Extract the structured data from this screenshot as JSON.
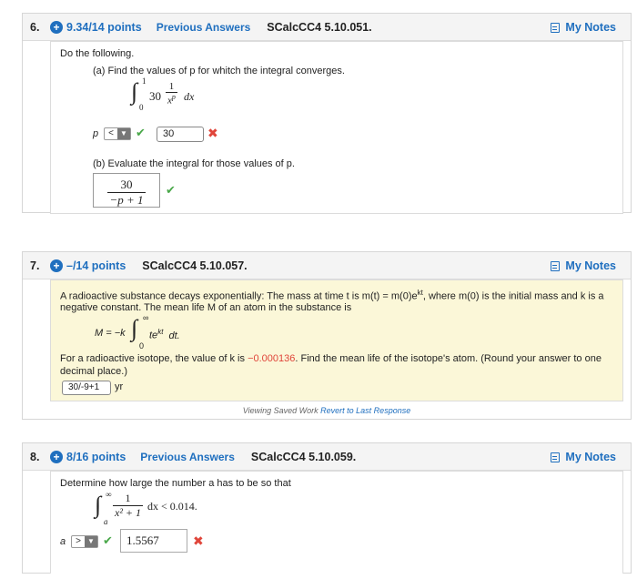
{
  "q6": {
    "number": "6.",
    "points": "9.34/14 points",
    "previous_answers": "Previous Answers",
    "id": "SCalcCC4 5.10.051.",
    "my_notes": "My Notes",
    "instruction": "Do the following.",
    "part_a": "(a) Find the values of p for whitch the integral converges.",
    "integral_coef": "30",
    "integral_upper": "1",
    "integral_lower": "0",
    "frac_num": "1",
    "frac_den": "x",
    "frac_den_exp": "p",
    "dx": "dx",
    "p_label": "p",
    "p_select_value": "<",
    "p_input_value": "30",
    "part_b": "(b) Evaluate the integral for those values of p.",
    "b_num": "30",
    "b_den": "−p + 1"
  },
  "q7": {
    "number": "7.",
    "points": "–/14 points",
    "id": "SCalcCC4 5.10.057.",
    "my_notes": "My Notes",
    "line1": "A radioactive substance decays exponentially: The mass at time t is m(t) = m(0)e",
    "line1_exp": "kt",
    "line1_rest": ", where m(0) is the initial mass and k is a",
    "line2": "negative constant. The mean life M of an atom in the substance is",
    "formula_lhs": "M = −k",
    "formula_upper": "∞",
    "formula_lower": "0",
    "formula_body": "te",
    "formula_exp": "kt",
    "formula_dt": "dt.",
    "line3_pre": "For a radioactive isotope, the value of k is ",
    "k_value": "−0.000136",
    "line3_post": ". Find the mean life of the isotope's atom. (Round your answer to one",
    "line4": "decimal place.)",
    "answer_value": "30/-9+1",
    "unit": "yr"
  },
  "saved_work": {
    "text": "Viewing Saved Work",
    "link": "Revert to Last Response"
  },
  "q8": {
    "number": "8.",
    "points": "8/16 points",
    "previous_answers": "Previous Answers",
    "id": "SCalcCC4 5.10.059.",
    "my_notes": "My Notes",
    "instruction": "Determine how large the number a has to be so that",
    "upper": "∞",
    "lower": "a",
    "frac_num": "1",
    "frac_den": "x² + 1",
    "tail": "dx < 0.014.",
    "a_label": "a",
    "a_select_value": ">",
    "a_input_value": "1.5567"
  },
  "colors": {
    "link_blue": "#1f6fbf",
    "correct_green": "#4aa84a",
    "wrong_red": "#e0453a",
    "highlight_yellow": "#fbf7d8",
    "k_red": "#e0453a"
  }
}
